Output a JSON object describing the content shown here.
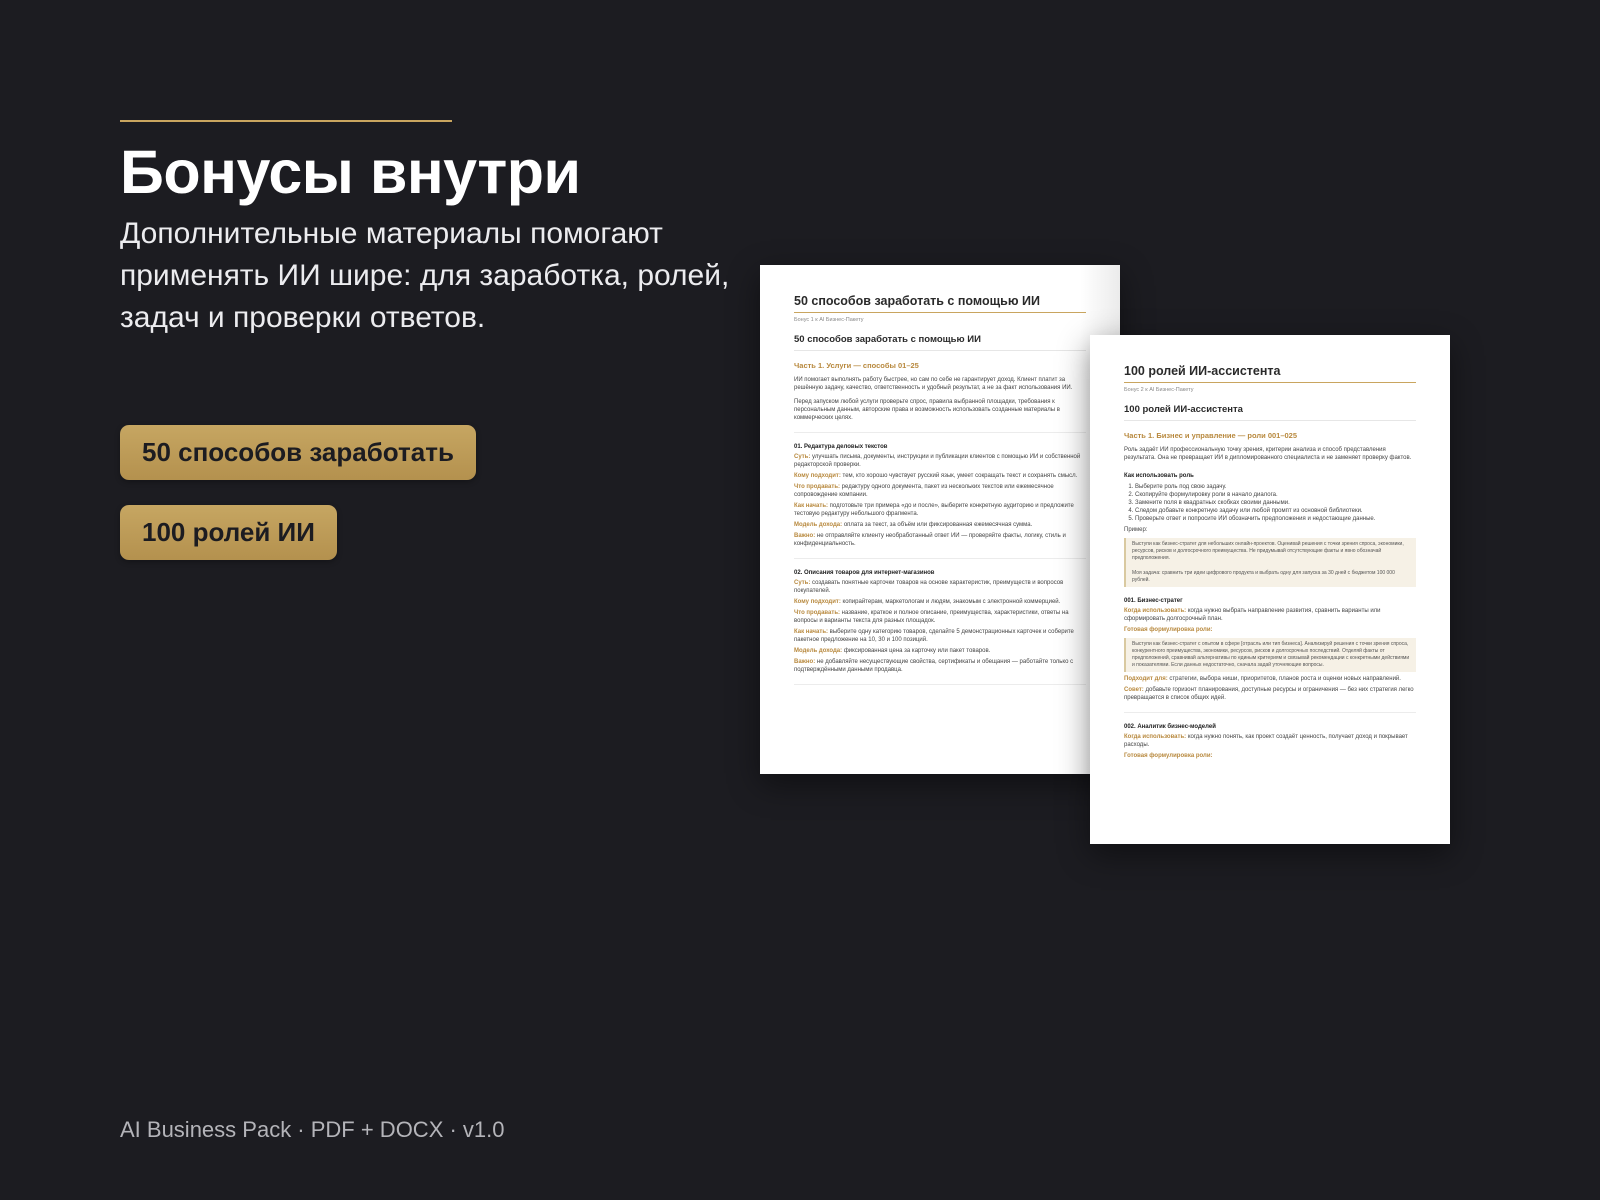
{
  "hero": {
    "title": "Бонусы внутри",
    "subtitle": "Дополнительные материалы помогают применять ИИ шире: для заработка, ролей, задач и проверки ответов."
  },
  "bonuses": [
    {
      "label": "50 способов заработать"
    },
    {
      "label": "100 ролей ИИ"
    }
  ],
  "footer": {
    "text": "AI Business Pack · PDF + DOCX · v1.0"
  },
  "colors": {
    "background": "#1c1c21",
    "accent": "#c9a55f"
  },
  "doc1": {
    "header": "50 способов заработать с помощью ИИ",
    "sub": "Бонус 1 к AI Бизнес-Пакету",
    "title": "50 способов заработать с помощью ИИ",
    "part": "Часть 1. Услуги — способы 01–25",
    "intro1": "ИИ помогает выполнять работу быстрее, но сам по себе не гарантирует доход. Клиент платит за решённую задачу, качество, ответственность и удобный результат, а не за факт использования ИИ.",
    "intro2": "Перед запуском любой услуги проверьте спрос, правила выбранной площадки, требования к персональным данным, авторские права и возможность использовать созданные материалы в коммерческих целях.",
    "sections": [
      {
        "heading": "01. Редактура деловых текстов",
        "items": [
          {
            "label": "Суть:",
            "text": "улучшать письма, документы, инструкции и публикации клиентов с помощью ИИ и собственной редакторской проверки."
          },
          {
            "label": "Кому подходит:",
            "text": "тем, кто хорошо чувствует русский язык, умеет сокращать текст и сохранять смысл."
          },
          {
            "label": "Что продавать:",
            "text": "редактуру одного документа, пакет из нескольких текстов или ежемесячное сопровождение компании."
          },
          {
            "label": "Как начать:",
            "text": "подготовьте три примера «до и после», выберите конкретную аудиторию и предложите тестовую редактуру небольшого фрагмента."
          },
          {
            "label": "Модель дохода:",
            "text": "оплата за текст, за объём или фиксированная ежемесячная сумма."
          },
          {
            "label": "Важно:",
            "text": "не отправляйте клиенту необработанный ответ ИИ — проверяйте факты, логику, стиль и конфиденциальность."
          }
        ]
      },
      {
        "heading": "02. Описания товаров для интернет-магазинов",
        "items": [
          {
            "label": "Суть:",
            "text": "создавать понятные карточки товаров на основе характеристик, преимуществ и вопросов покупателей."
          },
          {
            "label": "Кому подходит:",
            "text": "копирайтерам, маркетологам и людям, знакомым с электронной коммерцией."
          },
          {
            "label": "Что продавать:",
            "text": "название, краткое и полное описание, преимущества, характеристики, ответы на вопросы и варианты текста для разных площадок."
          },
          {
            "label": "Как начать:",
            "text": "выберите одну категорию товаров, сделайте 5 демонстрационных карточек и соберите пакетное предложение на 10, 30 и 100 позиций."
          },
          {
            "label": "Модель дохода:",
            "text": "фиксированная цена за карточку или пакет товаров."
          },
          {
            "label": "Важно:",
            "text": "не добавляйте несуществующие свойства, сертификаты и обещания — работайте только с подтверждёнными данными продавца."
          }
        ]
      }
    ]
  },
  "doc2": {
    "header": "100 ролей ИИ-ассистента",
    "sub": "Бонус 2 к AI Бизнес-Пакету",
    "title": "100 ролей ИИ-ассистента",
    "part": "Часть 1. Бизнес и управление — роли 001–025",
    "intro": "Роль задаёт ИИ профессиональную точку зрения, критерии анализа и способ представления результата. Она не превращает ИИ в дипломированного специалиста и не заменяет проверку фактов.",
    "howto_heading": "Как использовать роль",
    "steps": [
      "Выберите роль под свою задачу.",
      "Скопируйте формулировку роли в начало диалога.",
      "Замените поля в квадратных скобках своими данными.",
      "Следом добавьте конкретную задачу или любой промпт из основной библиотеки.",
      "Проверьте ответ и попросите ИИ обозначить предположения и недостающие данные."
    ],
    "example_label": "Пример:",
    "example1": "Выступи как бизнес-стратег для небольших онлайн-проектов. Оценивай решения с точки зрения спроса, экономики, ресурсов, рисков и долгосрочного преимущества. Не придумывай отсутствующие факты и явно обозначай предположения.",
    "example2": "Моя задача: сравнить три идеи цифрового продукта и выбрать одну для запуска за 30 дней с бюджетом 100 000 рублей.",
    "role1_heading": "001. Бизнес-стратег",
    "role1_when_label": "Когда использовать:",
    "role1_when": "когда нужно выбрать направление развития, сравнить варианты или сформировать долгосрочный план.",
    "role1_prompt_label": "Готовая формулировка роли:",
    "role1_prompt": "Выступи как бизнес-стратег с опытом в сфере [отрасль или тип бизнеса]. Анализируй решения с точки зрения спроса, конкурентного преимущества, экономики, ресурсов, рисков и долгосрочных последствий. Отделяй факты от предположений, сравнивай альтернативы по единым критериям и связывай рекомендации с конкретными действиями и показателями. Если данных недостаточно, сначала задай уточняющие вопросы.",
    "role1_fit_label": "Подходит для:",
    "role1_fit": "стратегии, выбора ниши, приоритетов, планов роста и оценки новых направлений.",
    "role1_tip_label": "Совет:",
    "role1_tip": "добавьте горизонт планирования, доступные ресурсы и ограничения — без них стратегия легко превращается в список общих идей.",
    "role2_heading": "002. Аналитик бизнес-моделей",
    "role2_when_label": "Когда использовать:",
    "role2_when": "когда нужно понять, как проект создаёт ценность, получает доход и покрывает расходы.",
    "role2_prompt_label": "Готовая формулировка роли:"
  }
}
